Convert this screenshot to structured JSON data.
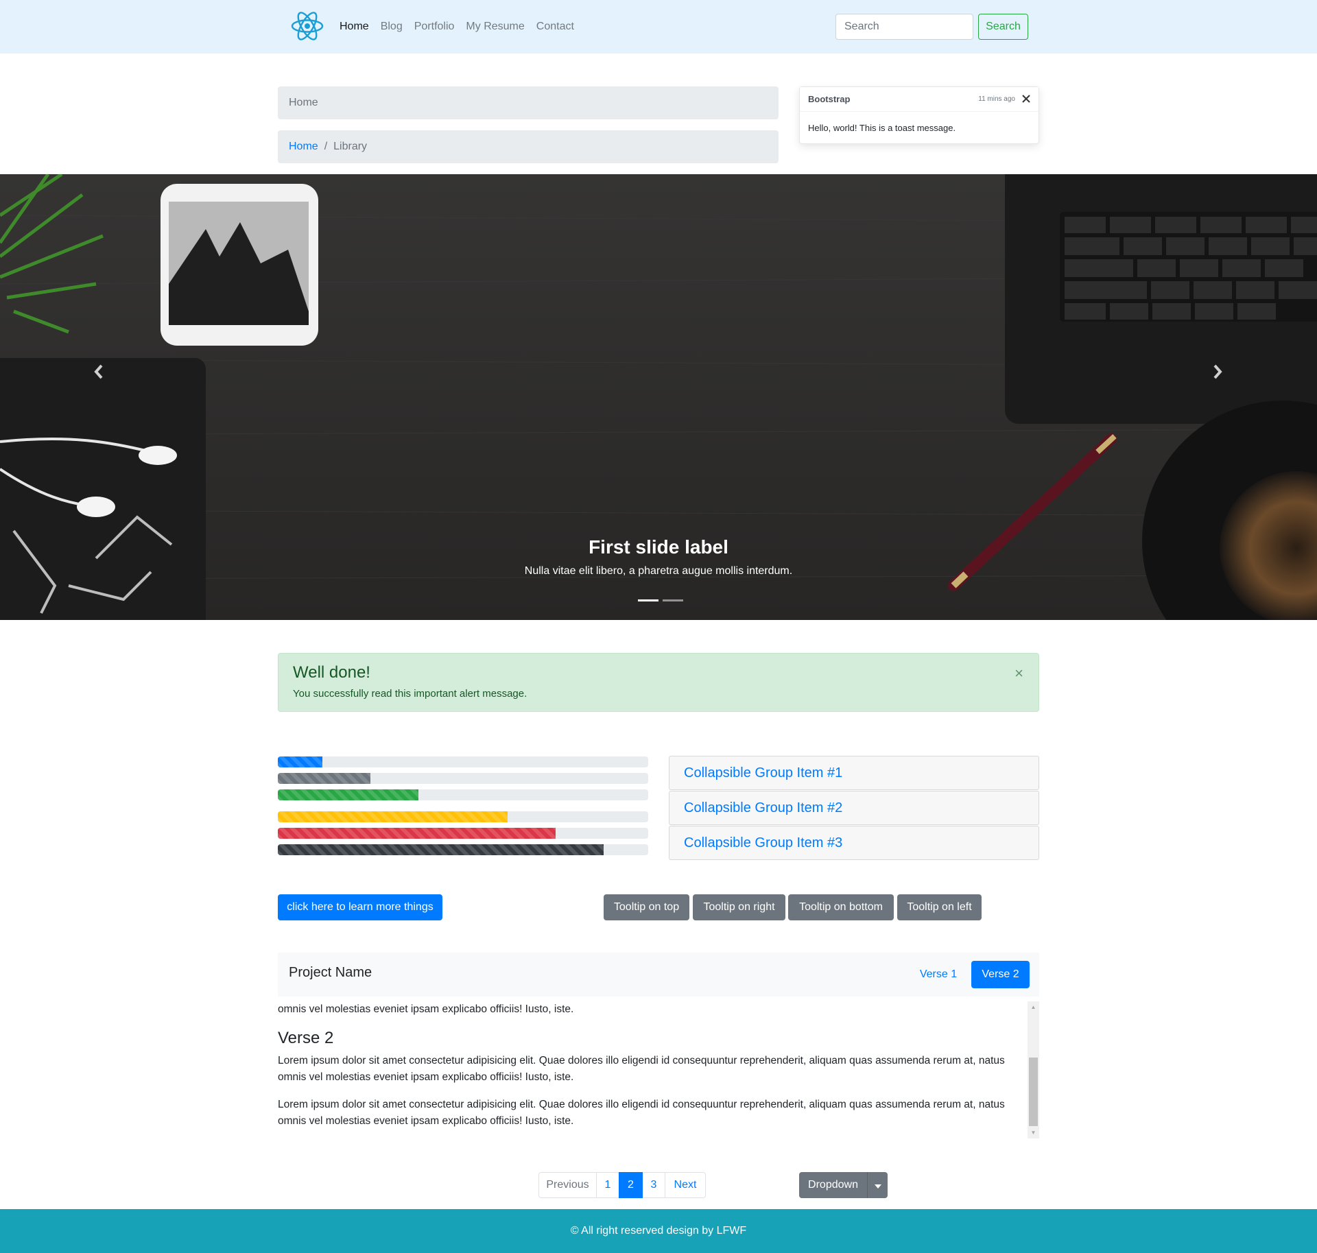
{
  "navbar": {
    "links": [
      "Home",
      "Blog",
      "Portfolio",
      "My Resume",
      "Contact"
    ],
    "active_index": 0,
    "search_placeholder": "Search",
    "search_button": "Search"
  },
  "breadcrumb1": {
    "items": [
      "Home"
    ]
  },
  "breadcrumb2": {
    "items": [
      "Home",
      "Library"
    ],
    "separator": "/"
  },
  "toast": {
    "title": "Bootstrap",
    "time": "11 mins ago",
    "body": "Hello, world! This is a toast message."
  },
  "carousel": {
    "caption_title": "First slide label",
    "caption_text": "Nulla vitae elit libero, a pharetra augue mollis interdum.",
    "active_slide": 0,
    "slide_count": 2
  },
  "alert": {
    "heading": "Well done!",
    "text": "You successfully read this important alert message.",
    "close": "×"
  },
  "progress_bars": [
    {
      "value": 12,
      "color": "#007bff"
    },
    {
      "value": 25,
      "color": "#6c757d"
    },
    {
      "value": 38,
      "color": "#28a745"
    },
    {
      "value": 62,
      "color": "#ffc107"
    },
    {
      "value": 75,
      "color": "#dc3545"
    },
    {
      "value": 88,
      "color": "#343a40"
    }
  ],
  "accordion": {
    "items": [
      "Collapsible Group Item #1",
      "Collapsible Group Item #2",
      "Collapsible Group Item #3"
    ]
  },
  "buttons": {
    "learn_more": "click here to learn more things",
    "tooltips": [
      "Tooltip on top",
      "Tooltip on right",
      "Tooltip on bottom",
      "Tooltip on left"
    ]
  },
  "scrollspy": {
    "brand": "Project Name",
    "pills": [
      "Verse 1",
      "Verse 2"
    ],
    "active_pill": 1,
    "partial_text": "omnis vel molestias eveniet ipsam explicabo officiis! Iusto, iste.",
    "heading": "Verse 2",
    "paragraphs": [
      "Lorem ipsum dolor sit amet consectetur adipisicing elit. Quae dolores illo eligendi id consequuntur reprehenderit, aliquam quas assumenda rerum at, natus omnis vel molestias eveniet ipsam explicabo officiis! Iusto, iste.",
      "Lorem ipsum dolor sit amet consectetur adipisicing elit. Quae dolores illo eligendi id consequuntur reprehenderit, aliquam quas assumenda rerum at, natus omnis vel molestias eveniet ipsam explicabo officiis! Iusto, iste."
    ]
  },
  "pagination": {
    "previous": "Previous",
    "pages": [
      "1",
      "2",
      "3"
    ],
    "next": "Next",
    "active_page": "2"
  },
  "dropdown": {
    "label": "Dropdown"
  },
  "footer": {
    "text": "© All right reserved design by LFWF"
  },
  "colors": {
    "navbar_bg": "#e3f2fd",
    "primary": "#007bff",
    "success": "#28a745",
    "secondary": "#6c757d",
    "footer_bg": "#17a2b8",
    "alert_bg": "#d4edda",
    "logo": "#1a9ed4"
  },
  "icons": {
    "logo": "atom-logo-icon",
    "toast_close": "close-icon",
    "carousel_prev": "chevron-left-icon",
    "carousel_next": "chevron-right-icon",
    "dropdown_caret": "caret-down-icon"
  }
}
